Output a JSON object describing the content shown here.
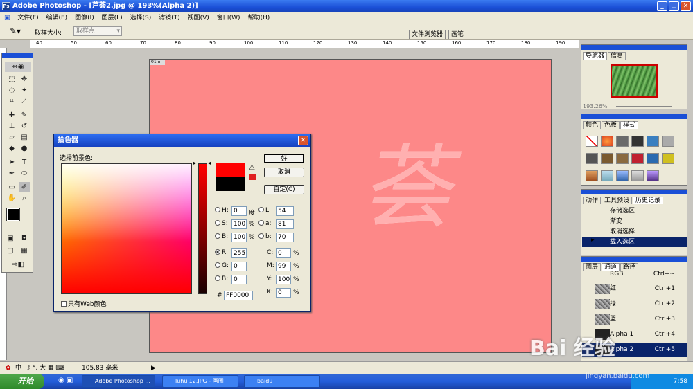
{
  "window": {
    "title": "Adobe Photoshop - [芦荟2.jpg @ 193%(Alpha 2)]"
  },
  "menu": [
    "文件(F)",
    "编辑(E)",
    "图像(I)",
    "图层(L)",
    "选择(S)",
    "滤镜(T)",
    "视图(V)",
    "窗口(W)",
    "帮助(H)"
  ],
  "options": {
    "sample_label": "取样大小:",
    "sample_value": "取样点",
    "tab_browser": "文件浏览器",
    "tab_brush": "画笔"
  },
  "ruler": {
    "top_ticks": [
      "40",
      "50",
      "60",
      "70",
      "80",
      "90",
      "100",
      "110",
      "120",
      "130",
      "140",
      "150",
      "160",
      "170",
      "180",
      "190"
    ]
  },
  "dialog": {
    "title": "拾色器",
    "subtitle": "选择前景色:",
    "ok": "好",
    "cancel": "取消",
    "custom": "自定(C)",
    "web_only": "只有Web颜色",
    "fields": {
      "H": {
        "label": "H:",
        "value": "0",
        "unit": "度"
      },
      "S": {
        "label": "S:",
        "value": "100",
        "unit": "%"
      },
      "B": {
        "label": "B:",
        "value": "100",
        "unit": "%"
      },
      "R": {
        "label": "R:",
        "value": "255"
      },
      "G": {
        "label": "G:",
        "value": "0"
      },
      "Bl": {
        "label": "B:",
        "value": "0"
      },
      "L": {
        "label": "L:",
        "value": "54"
      },
      "a": {
        "label": "a:",
        "value": "81"
      },
      "b": {
        "label": "b:",
        "value": "70"
      },
      "C": {
        "label": "C:",
        "value": "0",
        "unit": "%"
      },
      "M": {
        "label": "M:",
        "value": "99",
        "unit": "%"
      },
      "Y": {
        "label": "Y:",
        "value": "100",
        "unit": "%"
      },
      "K": {
        "label": "K:",
        "value": "0",
        "unit": "%"
      },
      "hex": {
        "label": "#",
        "value": "FF0000"
      }
    },
    "colors": {
      "new": "#ff0000",
      "old": "#000000"
    }
  },
  "navigator": {
    "tab1": "导航器",
    "tab2": "信息",
    "zoom": "193.26%"
  },
  "styles": {
    "tab1": "颜色",
    "tab2": "色板",
    "tab3": "样式"
  },
  "history": {
    "tab1": "动作",
    "tab2": "工具预设",
    "tab3": "历史记录",
    "items": [
      "存储选区",
      "渐变",
      "取消选择",
      "载入选区"
    ]
  },
  "channels": {
    "tab1": "图层",
    "tab2": "通道",
    "tab3": "路径",
    "items": [
      {
        "name": "RGB",
        "shortcut": "Ctrl+~"
      },
      {
        "name": "红",
        "shortcut": "Ctrl+1"
      },
      {
        "name": "绿",
        "shortcut": "Ctrl+2"
      },
      {
        "name": "蓝",
        "shortcut": "Ctrl+3"
      },
      {
        "name": "Alpha 1",
        "shortcut": "Ctrl+4"
      },
      {
        "name": "Alpha 2",
        "shortcut": "Ctrl+5"
      }
    ]
  },
  "status": {
    "ime": "中",
    "zoom_value": "105.83 毫米"
  },
  "taskbar": {
    "start": "开始",
    "tasks": [
      "Adobe Photoshop ...",
      "luhui12.JPG - 画图",
      "baidu"
    ],
    "clock": "7:58"
  },
  "watermark": {
    "text": "Bai 经验",
    "sub": "jingyan.baidu.com"
  },
  "canvas": {
    "text": "荟"
  }
}
